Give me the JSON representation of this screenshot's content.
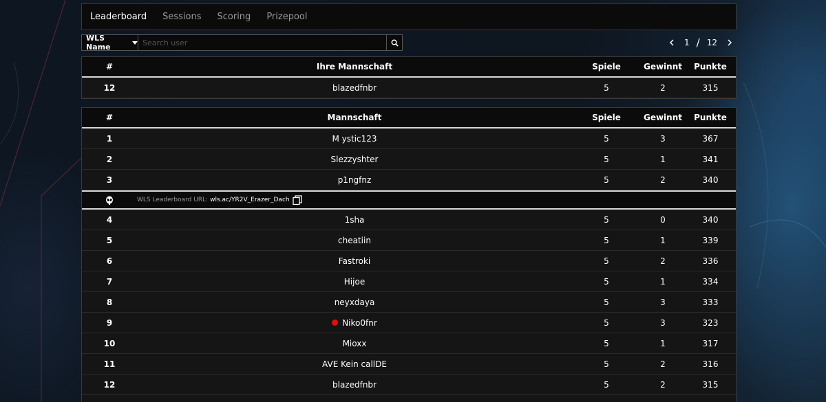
{
  "nav": {
    "tabs": [
      {
        "label": "Leaderboard",
        "active": true
      },
      {
        "label": "Sessions",
        "active": false
      },
      {
        "label": "Scoring",
        "active": false
      },
      {
        "label": "Prizepool",
        "active": false
      }
    ]
  },
  "search": {
    "filter_label": "WLS Name",
    "placeholder": "Search user",
    "button_icon": "search-icon"
  },
  "pagination": {
    "current": "1",
    "separator": "/",
    "total": "12",
    "prev_icon": "chevron-left-icon",
    "next_icon": "chevron-right-icon"
  },
  "my_team_table": {
    "headers": {
      "rank": "#",
      "team": "Ihre Mannschaft",
      "games": "Spiele",
      "wins": "Gewinnt",
      "points": "Punkte"
    },
    "row": {
      "rank": "12",
      "team": "blazedfnbr",
      "games": "5",
      "wins": "2",
      "points": "315"
    }
  },
  "leaderboard": {
    "headers": {
      "rank": "#",
      "team": "Mannschaft",
      "games": "Spiele",
      "wins": "Gewinnt",
      "points": "Punkte"
    },
    "rows_top": [
      {
        "rank": "1",
        "team": "M ystic123",
        "games": "5",
        "wins": "3",
        "points": "367"
      },
      {
        "rank": "2",
        "team": "Slezzyshter",
        "games": "5",
        "wins": "1",
        "points": "341"
      },
      {
        "rank": "3",
        "team": "p1ngfnz",
        "games": "5",
        "wins": "2",
        "points": "340"
      }
    ],
    "banner": {
      "icon": "alien-icon",
      "label": "WLS Leaderboard URL:",
      "url": "wls.ac/YR2V_Erazer_Dach",
      "copy_icon": "copy-icon"
    },
    "rows_rest": [
      {
        "rank": "4",
        "team": "1sha",
        "games": "5",
        "wins": "0",
        "points": "340"
      },
      {
        "rank": "5",
        "team": "cheatiin",
        "games": "5",
        "wins": "1",
        "points": "339"
      },
      {
        "rank": "6",
        "team": "Fastroki",
        "games": "5",
        "wins": "2",
        "points": "336"
      },
      {
        "rank": "7",
        "team": "Hijoe",
        "games": "5",
        "wins": "1",
        "points": "334"
      },
      {
        "rank": "8",
        "team": "neyxdaya",
        "games": "5",
        "wins": "3",
        "points": "333"
      },
      {
        "rank": "9",
        "team": "Niko0fnr",
        "games": "5",
        "wins": "3",
        "points": "323",
        "live": true
      },
      {
        "rank": "10",
        "team": "Mioxx",
        "games": "5",
        "wins": "1",
        "points": "317"
      },
      {
        "rank": "11",
        "team": "AVE Kein callDE",
        "games": "5",
        "wins": "2",
        "points": "316"
      },
      {
        "rank": "12",
        "team": "blazedfnbr",
        "games": "5",
        "wins": "2",
        "points": "315"
      }
    ]
  },
  "colors": {
    "accent_live": "#e01010",
    "panel": "#151515",
    "header": "#0b0b0b"
  }
}
